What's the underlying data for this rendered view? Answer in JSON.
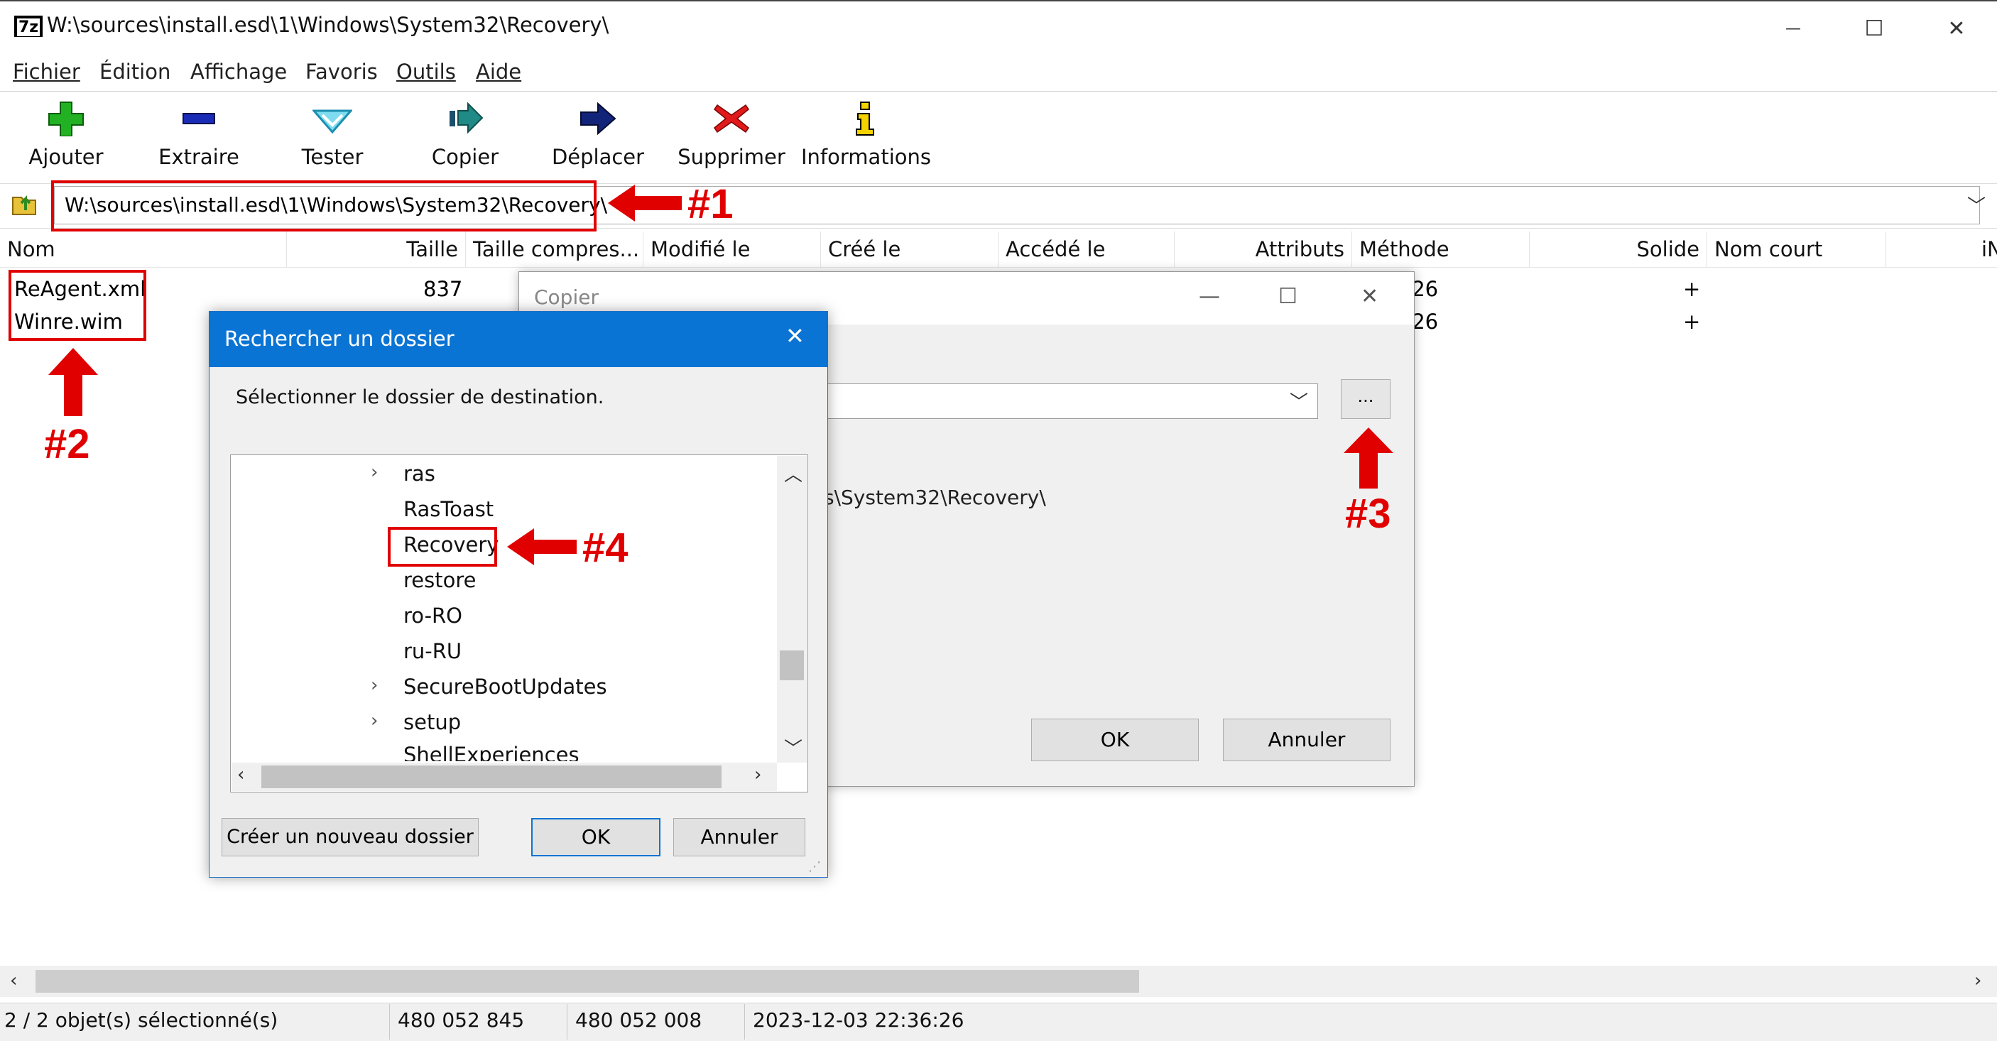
{
  "window": {
    "title": "W:\\sources\\install.esd\\1\\Windows\\System32\\Recovery\\",
    "icon_label": "7z",
    "minimize_glyph": "—",
    "maximize_glyph": "☐",
    "close_glyph": "✕"
  },
  "menu": [
    "Fichier",
    "Édition",
    "Affichage",
    "Favoris",
    "Outils",
    "Aide"
  ],
  "toolbar": [
    {
      "label": "Ajouter",
      "icon": "add-plus-icon",
      "color": "#22b122"
    },
    {
      "label": "Extraire",
      "icon": "extract-minus-icon",
      "color": "#1a2bb5"
    },
    {
      "label": "Tester",
      "icon": "test-check-icon",
      "color": "#2bb6d8"
    },
    {
      "label": "Copier",
      "icon": "copy-arrow-icon",
      "color": "#208a86"
    },
    {
      "label": "Déplacer",
      "icon": "move-arrow-icon",
      "color": "#12237a"
    },
    {
      "label": "Supprimer",
      "icon": "delete-x-icon",
      "color": "#e01a1a"
    },
    {
      "label": "Informations",
      "icon": "info-icon",
      "color": "#e8c000"
    }
  ],
  "address": {
    "path": "W:\\sources\\install.esd\\1\\Windows\\System32\\Recovery\\"
  },
  "columns": [
    "Nom",
    "Taille",
    "Taille compres...",
    "Modifié le",
    "Créé le",
    "Accédé le",
    "Attributs",
    "Méthode",
    "Solide",
    "Nom court",
    "iN"
  ],
  "files": [
    {
      "name": "ReAgent.xml",
      "size": "837",
      "modified_partial": "5:26",
      "solid": "+"
    },
    {
      "name": "Winre.wim",
      "size": "",
      "modified_partial": "5:26",
      "solid": "+"
    }
  ],
  "copy_dialog": {
    "title": "Copier",
    "browse_label": "...",
    "path_fragment": "s\\System32\\Recovery\\",
    "paren_fragment": ")",
    "ok": "OK",
    "cancel": "Annuler"
  },
  "browse_dialog": {
    "title": "Rechercher un dossier",
    "prompt": "Sélectionner le dossier de destination.",
    "tree": [
      {
        "label": "ras",
        "expandable": true
      },
      {
        "label": "RasToast",
        "expandable": false
      },
      {
        "label": "Recovery",
        "expandable": false,
        "selected": true
      },
      {
        "label": "restore",
        "expandable": false
      },
      {
        "label": "ro-RO",
        "expandable": false
      },
      {
        "label": "ru-RU",
        "expandable": false
      },
      {
        "label": "SecureBootUpdates",
        "expandable": true
      },
      {
        "label": "setup",
        "expandable": true
      },
      {
        "label": "ShellExperiences",
        "expandable": false
      }
    ],
    "new_folder": "Créer un nouveau dossier",
    "ok": "OK",
    "cancel": "Annuler"
  },
  "annotations": [
    "#1",
    "#2",
    "#3",
    "#4"
  ],
  "status": {
    "selection": "2 / 2 objet(s) sélectionné(s)",
    "size": "480 052 845",
    "packed": "480 052 008",
    "date": "2023-12-03 22:36:26"
  },
  "colors": {
    "accent": "#0a74d4",
    "annotation_red": "#e00000"
  }
}
